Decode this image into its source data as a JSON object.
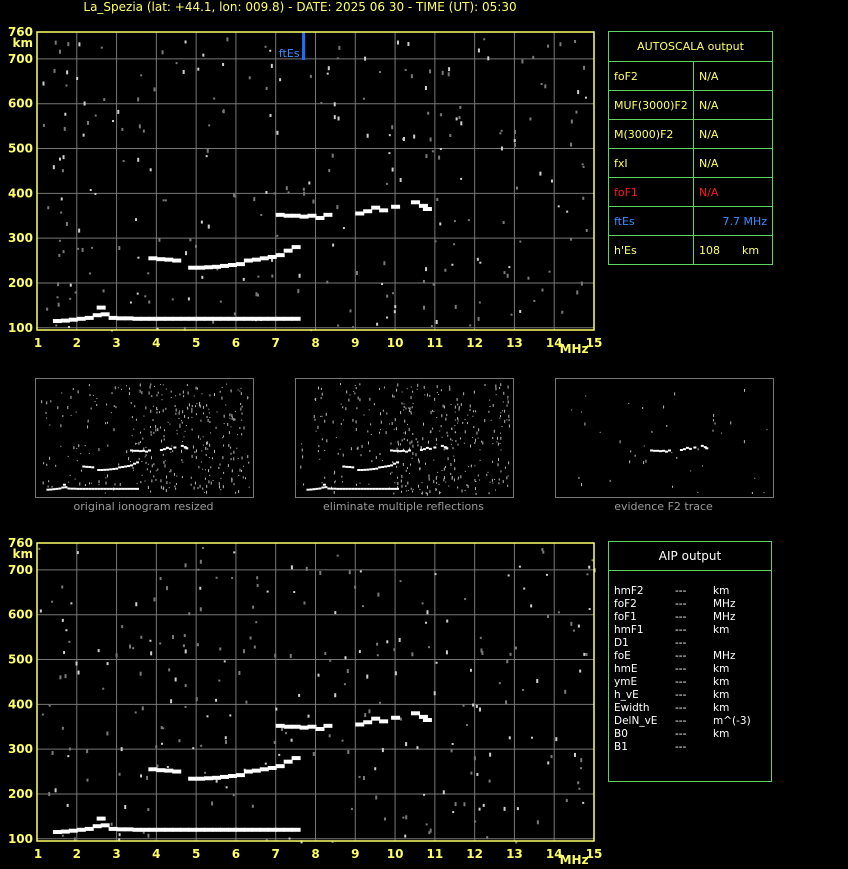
{
  "header": {
    "title": "La_Spezia (lat: +44.1, lon: 009.8) - DATE: 2025 06 30 - TIME (UT): 05:30"
  },
  "colors": {
    "axis": "#ffff66",
    "grid": "#777777",
    "echo": "#ffffff",
    "marker": "#1e6fff",
    "table_border": "#5fd35f",
    "foF1_red": "#ff1a1a",
    "ftEs_blue": "#3a8dff"
  },
  "chart_data": [
    {
      "type": "scatter",
      "xlabel": "MHz",
      "ylabel": "km",
      "xlim": [
        1,
        15
      ],
      "ylim": [
        95,
        760
      ],
      "x_ticks": [
        "1",
        "2",
        "3",
        "4",
        "5",
        "6",
        "7",
        "8",
        "9",
        "10",
        "11",
        "12",
        "13",
        "14",
        "15"
      ],
      "y_ticks": [
        "100",
        "200",
        "300",
        "400",
        "500",
        "600",
        "700",
        "760"
      ],
      "grid": true,
      "annotation": {
        "text": "ftEs",
        "x": 7.7
      },
      "traces": [
        {
          "name": "",
          "x": [
            1.5,
            1.7,
            1.9,
            2.1,
            2.3,
            2.5,
            2.6,
            2.7,
            2.9,
            3.1,
            3.3,
            3.5,
            3.7,
            3.9,
            4.1,
            4.3,
            4.5,
            4.7,
            4.9,
            5.1,
            5.3,
            5.5,
            5.7,
            5.9,
            6.1,
            6.3,
            6.5,
            6.7,
            6.9,
            7.1,
            7.3,
            7.5
          ],
          "y": [
            115,
            116,
            118,
            120,
            122,
            128,
            145,
            130,
            122,
            121,
            121,
            120,
            120,
            120,
            120,
            120,
            120,
            120,
            120,
            120,
            120,
            120,
            120,
            120,
            120,
            120,
            120,
            120,
            120,
            120,
            120,
            120
          ]
        },
        {
          "name": "",
          "x": [
            3.9,
            4.1,
            4.3,
            4.5,
            4.9,
            5.1,
            5.3,
            5.5,
            5.7,
            5.9,
            6.1,
            6.3,
            6.5,
            6.7,
            6.9,
            7.1,
            7.3,
            7.5
          ],
          "y": [
            255,
            253,
            252,
            250,
            234,
            234,
            235,
            236,
            238,
            240,
            242,
            250,
            252,
            255,
            258,
            262,
            272,
            280
          ]
        },
        {
          "name": "",
          "x": [
            7.1,
            7.3,
            7.5,
            7.7,
            7.9,
            8.1,
            8.3
          ],
          "y": [
            352,
            350,
            350,
            348,
            350,
            345,
            352
          ]
        },
        {
          "name": "",
          "x": [
            9.1,
            9.3,
            9.5,
            9.7,
            10.0,
            10.5,
            10.7,
            10.8
          ],
          "y": [
            355,
            360,
            368,
            362,
            370,
            380,
            372,
            365
          ]
        }
      ]
    },
    {
      "type": "scatter",
      "xlabel": "MHz",
      "ylabel": "km",
      "xlim": [
        1,
        15
      ],
      "ylim": [
        95,
        760
      ],
      "x_ticks": [
        "1",
        "2",
        "3",
        "4",
        "5",
        "6",
        "7",
        "8",
        "9",
        "10",
        "11",
        "12",
        "13",
        "14",
        "15"
      ],
      "y_ticks": [
        "100",
        "200",
        "300",
        "400",
        "500",
        "600",
        "700",
        "760"
      ],
      "grid": true,
      "traces": [
        {
          "name": "",
          "x": [
            1.5,
            1.7,
            1.9,
            2.1,
            2.3,
            2.5,
            2.6,
            2.7,
            2.9,
            3.1,
            3.3,
            3.5,
            3.7,
            3.9,
            4.1,
            4.3,
            4.5,
            4.7,
            4.9,
            5.1,
            5.3,
            5.5,
            5.7,
            5.9,
            6.1,
            6.3,
            6.5,
            6.7,
            6.9,
            7.1,
            7.3,
            7.5
          ],
          "y": [
            115,
            116,
            118,
            120,
            122,
            128,
            145,
            130,
            122,
            121,
            121,
            120,
            120,
            120,
            120,
            120,
            120,
            120,
            120,
            120,
            120,
            120,
            120,
            120,
            120,
            120,
            120,
            120,
            120,
            120,
            120,
            120
          ]
        },
        {
          "name": "",
          "x": [
            3.9,
            4.1,
            4.3,
            4.5,
            4.9,
            5.1,
            5.3,
            5.5,
            5.7,
            5.9,
            6.1,
            6.3,
            6.5,
            6.7,
            6.9,
            7.1,
            7.3,
            7.5
          ],
          "y": [
            255,
            253,
            252,
            250,
            234,
            234,
            235,
            236,
            238,
            240,
            242,
            250,
            252,
            255,
            258,
            262,
            272,
            280
          ]
        },
        {
          "name": "",
          "x": [
            7.1,
            7.3,
            7.5,
            7.7,
            7.9,
            8.1,
            8.3
          ],
          "y": [
            352,
            350,
            350,
            348,
            350,
            345,
            352
          ]
        },
        {
          "name": "",
          "x": [
            9.1,
            9.3,
            9.5,
            9.7,
            10.0,
            10.5,
            10.7,
            10.8
          ],
          "y": [
            355,
            360,
            368,
            362,
            370,
            380,
            372,
            365
          ]
        }
      ]
    }
  ],
  "thumbnails": [
    {
      "caption": "original ionogram resized"
    },
    {
      "caption": "eliminate multiple reflections"
    },
    {
      "caption": "evidence F2 trace"
    }
  ],
  "autoscala": {
    "title": "AUTOSCALA output",
    "rows": [
      {
        "label": "foF2",
        "value": "N/A",
        "unit": ""
      },
      {
        "label": "MUF(3000)F2",
        "value": "N/A",
        "unit": ""
      },
      {
        "label": "M(3000)F2",
        "value": "N/A",
        "unit": ""
      },
      {
        "label": "fxI",
        "value": "N/A",
        "unit": ""
      },
      {
        "label": "foF1",
        "value": "N/A",
        "unit": ""
      },
      {
        "label": "ftEs",
        "value": "7.7 MHz",
        "unit": ""
      },
      {
        "label": "h'Es",
        "value": "108",
        "unit": "km"
      }
    ]
  },
  "aip": {
    "title": "AIP output",
    "rows": [
      {
        "label": "hmF2",
        "value": "---",
        "unit": "km"
      },
      {
        "label": "foF2",
        "value": "---",
        "unit": "MHz"
      },
      {
        "label": "foF1",
        "value": "---",
        "unit": "MHz"
      },
      {
        "label": "hmF1",
        "value": "---",
        "unit": "km"
      },
      {
        "label": "D1",
        "value": "---",
        "unit": ""
      },
      {
        "label": "foE",
        "value": "---",
        "unit": "MHz"
      },
      {
        "label": "hmE",
        "value": "---",
        "unit": "km"
      },
      {
        "label": "ymE",
        "value": "---",
        "unit": "km"
      },
      {
        "label": "h_vE",
        "value": "---",
        "unit": "km"
      },
      {
        "label": "Ewidth",
        "value": "---",
        "unit": "km"
      },
      {
        "label": "DelN_vE",
        "value": "---",
        "unit": "m^(-3)"
      },
      {
        "label": "B0",
        "value": "---",
        "unit": "km"
      },
      {
        "label": "B1",
        "value": "---",
        "unit": ""
      }
    ]
  }
}
